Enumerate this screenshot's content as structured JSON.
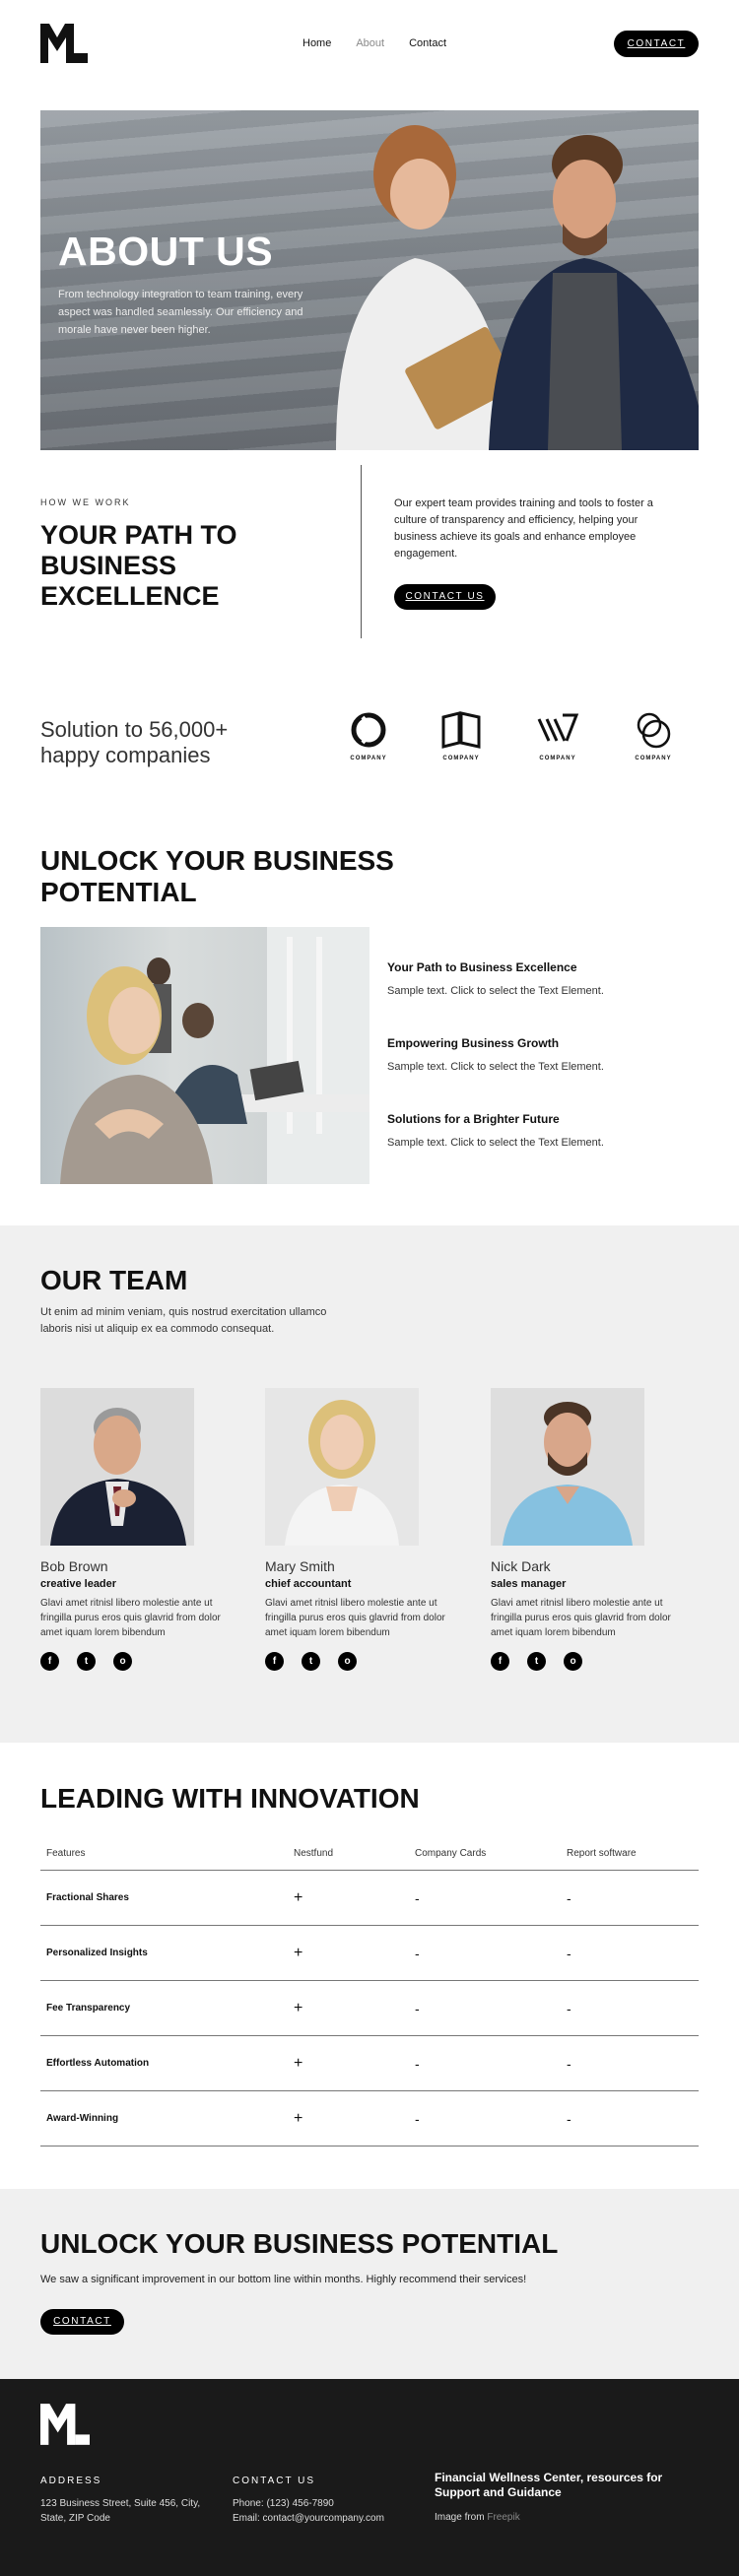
{
  "nav": {
    "home": "Home",
    "about": "About",
    "contact": "Contact",
    "cta": "CONTACT"
  },
  "hero": {
    "title": "ABOUT US",
    "text": "From technology integration to team training, every aspect was handled seamlessly. Our efficiency and morale have never been higher."
  },
  "how": {
    "label": "HOW WE WORK",
    "title": "YOUR PATH TO BUSINESS EXCELLENCE",
    "text": "Our expert team provides training and tools to foster a culture of transparency and efficiency, helping your business achieve its goals and enhance employee engagement.",
    "cta": "CONTACT US"
  },
  "companies": {
    "text": "Solution to 56,000+ happy companies",
    "logos": [
      "COMPANY",
      "COMPANY",
      "COMPANY",
      "COMPANY"
    ]
  },
  "unlock": {
    "title": "UNLOCK YOUR BUSINESS POTENTIAL",
    "features": [
      {
        "title": "Your Path to Business Excellence",
        "text": "Sample text. Click to select the Text Element."
      },
      {
        "title": "Empowering Business Growth",
        "text": "Sample text. Click to select the Text Element."
      },
      {
        "title": "Solutions for a Brighter Future",
        "text": "Sample text. Click to select the Text Element."
      }
    ]
  },
  "team": {
    "title": "OUR TEAM",
    "subtitle": "Ut enim ad minim veniam, quis nostrud exercitation ullamco laboris nisi ut aliquip ex ea commodo consequat.",
    "members": [
      {
        "name": "Bob Brown",
        "role": "creative leader",
        "bio": "Glavi amet ritnisl libero molestie ante ut fringilla purus eros quis glavrid from dolor amet iquam lorem bibendum"
      },
      {
        "name": "Mary Smith",
        "role": "chief accountant",
        "bio": "Glavi amet ritnisl libero molestie ante ut fringilla purus eros quis glavrid from dolor amet iquam lorem bibendum"
      },
      {
        "name": "Nick Dark",
        "role": "sales manager",
        "bio": "Glavi amet ritnisl libero molestie ante ut fringilla purus eros quis glavrid from dolor amet iquam lorem bibendum"
      }
    ],
    "social_icons": [
      "f",
      "t",
      "o"
    ]
  },
  "innovation": {
    "title": "LEADING WITH INNOVATION",
    "headers": [
      "Features",
      "Nestfund",
      "Company Cards",
      "Report software"
    ],
    "rows": [
      [
        "Fractional Shares",
        "+",
        "-",
        "-"
      ],
      [
        "Personalized Insights",
        "+",
        "-",
        "-"
      ],
      [
        "Fee Transparency",
        "+",
        "-",
        "-"
      ],
      [
        "Effortless Automation",
        "+",
        "-",
        "-"
      ],
      [
        "Award-Winning",
        "+",
        "-",
        "-"
      ]
    ]
  },
  "cta": {
    "title": "UNLOCK YOUR BUSINESS POTENTIAL",
    "text": "We saw a significant improvement in our bottom line within months. Highly recommend their services!",
    "button": "CONTACT"
  },
  "footer": {
    "address_head": "ADDRESS",
    "address": "123 Business Street, Suite 456, City, State, ZIP Code",
    "contact_head": "CONTACT US",
    "phone": "Phone: (123) 456-7890",
    "email": "Email: contact@yourcompany.com",
    "tagline": "Financial Wellness Center, resources for Support and Guidance",
    "credit_prefix": "Image from",
    "credit_link": "Freepik"
  }
}
